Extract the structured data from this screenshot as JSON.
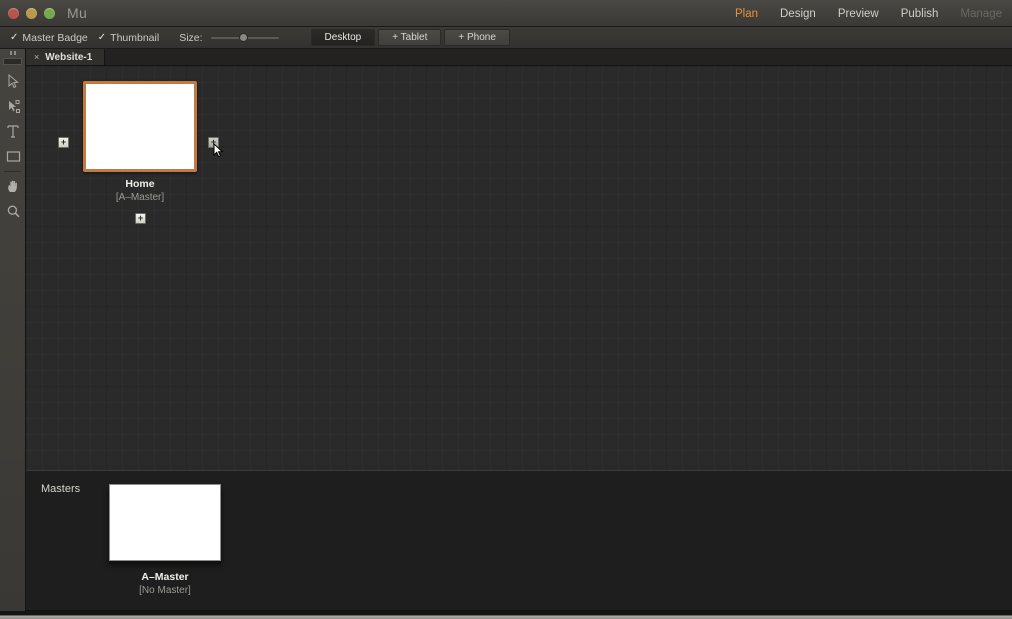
{
  "window": {
    "title": "Mu",
    "traffic_lights": [
      "close",
      "minimize",
      "zoom"
    ],
    "colors": {
      "accent": "#e8913c",
      "selection_border": "#c07a43",
      "canvas": "#2a2a2a"
    }
  },
  "nav": {
    "items": [
      {
        "label": "Plan",
        "state": "active"
      },
      {
        "label": "Design",
        "state": "normal"
      },
      {
        "label": "Preview",
        "state": "normal"
      },
      {
        "label": "Publish",
        "state": "normal"
      },
      {
        "label": "Manage",
        "state": "disabled"
      }
    ]
  },
  "toolbar": {
    "master_badge": {
      "label": "Master Badge",
      "checked": true,
      "tick": "✓"
    },
    "thumbnail": {
      "label": "Thumbnail",
      "checked": true,
      "tick": "✓"
    },
    "size": {
      "label": "Size:",
      "value": 41
    },
    "breakpoints": [
      {
        "label": "Desktop",
        "active": true
      },
      {
        "label": "+ Tablet",
        "active": false
      },
      {
        "label": "+ Phone",
        "active": false
      }
    ]
  },
  "tools": [
    {
      "name": "selection-tool-icon"
    },
    {
      "name": "direct-selection-tool-icon"
    },
    {
      "name": "text-tool-icon",
      "glyph": "T"
    },
    {
      "name": "rectangle-tool-icon"
    },
    {
      "name": "hand-tool-icon"
    },
    {
      "name": "zoom-tool-icon"
    }
  ],
  "tabs": [
    {
      "label": "Website-1",
      "close": "×",
      "active": true
    }
  ],
  "plan": {
    "page": {
      "name": "Home",
      "master": "[A–Master]",
      "selected": true,
      "add_buttons": [
        {
          "position": "left",
          "label": "+"
        },
        {
          "position": "right",
          "label": "+",
          "hovered": true
        },
        {
          "position": "bottom",
          "label": "+"
        }
      ]
    }
  },
  "masters": {
    "label": "Masters",
    "items": [
      {
        "name": "A–Master",
        "master": "[No Master]"
      }
    ]
  }
}
